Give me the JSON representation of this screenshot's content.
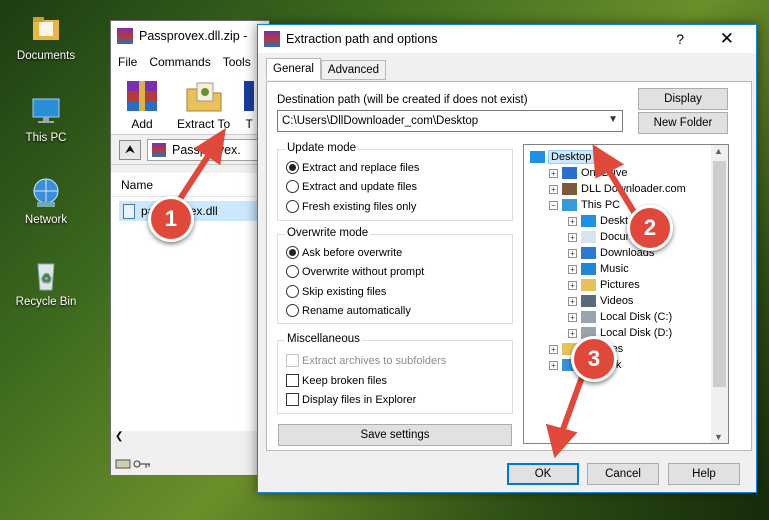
{
  "desktop": {
    "icons": [
      {
        "label": "Documents",
        "icon": "documents-folder-icon"
      },
      {
        "label": "This PC",
        "icon": "this-pc-icon"
      },
      {
        "label": "Network",
        "icon": "network-globe-icon"
      },
      {
        "label": "Recycle Bin",
        "icon": "recycle-bin-icon"
      }
    ]
  },
  "winrar": {
    "title": "Passprovex.dll.zip -",
    "menu": [
      "File",
      "Commands",
      "Tools"
    ],
    "toolbar": [
      {
        "label": "Add",
        "icon": "add-archive-icon"
      },
      {
        "label": "Extract To",
        "icon": "extract-to-icon"
      },
      {
        "label": "T",
        "icon": "test-icon"
      }
    ],
    "address": "Passprovex.",
    "column_name": "Name",
    "file": "passprovex.dll"
  },
  "dialog": {
    "title": "Extraction path and options",
    "help_glyph": "?",
    "close_glyph": "✕",
    "tabs": [
      "General",
      "Advanced"
    ],
    "dest_label": "Destination path (will be created if does not exist)",
    "dest_value": "C:\\Users\\DllDownloader_com\\Desktop",
    "display_btn": "Display",
    "new_folder_btn": "New Folder",
    "update_mode": {
      "title": "Update mode",
      "options": [
        {
          "label": "Extract and replace files",
          "selected": true
        },
        {
          "label": "Extract and update files",
          "selected": false
        },
        {
          "label": "Fresh existing files only",
          "selected": false
        }
      ]
    },
    "overwrite_mode": {
      "title": "Overwrite mode",
      "options": [
        {
          "label": "Ask before overwrite",
          "selected": true
        },
        {
          "label": "Overwrite without prompt",
          "selected": false
        },
        {
          "label": "Skip existing files",
          "selected": false
        },
        {
          "label": "Rename automatically",
          "selected": false
        }
      ]
    },
    "misc": {
      "title": "Miscellaneous",
      "options": [
        {
          "label": "Extract archives to subfolders",
          "checked": false,
          "disabled": true
        },
        {
          "label": "Keep broken files",
          "checked": false,
          "disabled": false
        },
        {
          "label": "Display files in Explorer",
          "checked": false,
          "disabled": false
        }
      ]
    },
    "save_settings_btn": "Save settings",
    "tree": [
      {
        "label": "Desktop",
        "icon": "desktop-folder-icon",
        "selected": true,
        "level": 0,
        "expander": ""
      },
      {
        "label": "OneDrive",
        "icon": "onedrive-icon",
        "level": 1,
        "expander": "+"
      },
      {
        "label": "DLL Downloader.com",
        "icon": "user-icon",
        "level": 1,
        "expander": "+"
      },
      {
        "label": "This PC",
        "icon": "this-pc-icon",
        "level": 1,
        "expander": "−"
      },
      {
        "label": "Desktop",
        "icon": "desktop-folder-icon",
        "level": 2,
        "expander": "+"
      },
      {
        "label": "Documents",
        "icon": "documents-icon",
        "level": 2,
        "expander": "+"
      },
      {
        "label": "Downloads",
        "icon": "downloads-icon",
        "level": 2,
        "expander": "+"
      },
      {
        "label": "Music",
        "icon": "music-icon",
        "level": 2,
        "expander": "+"
      },
      {
        "label": "Pictures",
        "icon": "pictures-icon",
        "level": 2,
        "expander": "+"
      },
      {
        "label": "Videos",
        "icon": "videos-icon",
        "level": 2,
        "expander": "+"
      },
      {
        "label": "Local Disk (C:)",
        "icon": "drive-c-icon",
        "level": 2,
        "expander": "+"
      },
      {
        "label": "Local Disk (D:)",
        "icon": "drive-d-icon",
        "level": 2,
        "expander": "+"
      },
      {
        "label": "Libraries",
        "icon": "libraries-icon",
        "level": 1,
        "expander": "+"
      },
      {
        "label": "Network",
        "icon": "network-icon",
        "level": 1,
        "expander": "+"
      }
    ],
    "ok_btn": "OK",
    "cancel_btn": "Cancel",
    "help_btn": "Help"
  },
  "annotations": [
    "1",
    "2",
    "3"
  ],
  "colors": {
    "annotation": "#e0483b",
    "selection": "#cce8ff",
    "accent": "#0078d7"
  }
}
